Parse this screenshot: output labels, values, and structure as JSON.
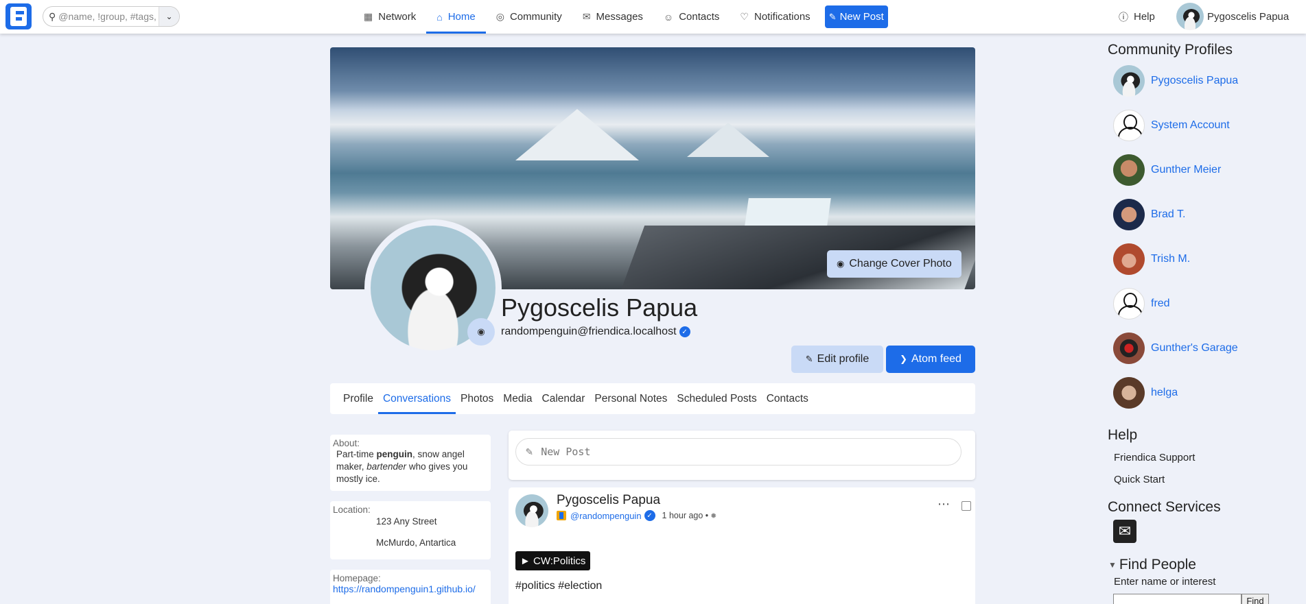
{
  "search": {
    "placeholder": "@name, !group, #tags, c"
  },
  "nav": {
    "items": [
      {
        "label": "Network",
        "icon": "table-icon"
      },
      {
        "label": "Home",
        "icon": "home-icon"
      },
      {
        "label": "Community",
        "icon": "target-icon"
      },
      {
        "label": "Messages",
        "icon": "envelope-icon"
      },
      {
        "label": "Contacts",
        "icon": "users-icon"
      },
      {
        "label": "Notifications",
        "icon": "bell-icon"
      }
    ],
    "active": "Home",
    "new_post": "New Post",
    "help": "Help",
    "user": "Pygoscelis Papua"
  },
  "profile": {
    "change_cover": "Change Cover Photo",
    "name": "Pygoscelis Papua",
    "handle": "randompenguin@friendica.localhost",
    "edit_profile": "Edit profile",
    "atom_feed": "Atom feed",
    "tabs": [
      "Profile",
      "Conversations",
      "Photos",
      "Media",
      "Calendar",
      "Personal Notes",
      "Scheduled Posts",
      "Contacts"
    ],
    "active_tab": "Conversations"
  },
  "about": {
    "label": "About:",
    "text_1": "Part-time ",
    "bold": "penguin",
    "text_2": ", snow angel maker, ",
    "italic": "bartender",
    "text_3": " who gives you mostly ice."
  },
  "location": {
    "label": "Location:",
    "line1": "123 Any Street",
    "line2": "McMurdo, Antartica"
  },
  "homepage": {
    "label": "Homepage:",
    "url": "https://randompenguin1.github.io/"
  },
  "new_post": {
    "placeholder": "New Post"
  },
  "post": {
    "author": "Pygoscelis Papua",
    "handle": "@randompenguin",
    "time": "1 hour ago •",
    "cw": "► CW:Politics",
    "tags": "#politics #election"
  },
  "aside": {
    "community_title": "Community Profiles",
    "profiles": [
      "Pygoscelis Papua",
      "System Account",
      "Gunther Meier",
      "Brad T.",
      "Trish M.",
      "fred",
      "Gunther's Garage",
      "helga"
    ],
    "help_title": "Help",
    "help_links": [
      "Friendica Support",
      "Quick Start"
    ],
    "connect_title": "Connect Services",
    "find_title": "Find People",
    "find_label": "Enter name or interest",
    "find_button": "Find"
  },
  "colors": {
    "accent": "#1d6ce8",
    "background": "#eef1f9",
    "button_light": "#c9daf6"
  }
}
